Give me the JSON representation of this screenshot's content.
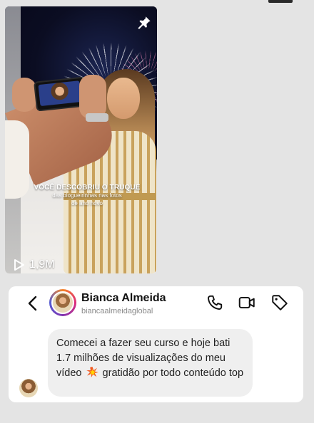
{
  "reel": {
    "caption_line1": "VOCÊ DESCOBRIU O TRUQUE",
    "caption_line2": "das blogueirinhas nas fotos",
    "caption_line3": "de ano novo",
    "views": "1,9M",
    "pin_icon": "pin-icon",
    "play_icon": "play-icon"
  },
  "dm": {
    "name": "Bianca Almeida",
    "handle": "biancaalmeidaglobal",
    "message_part1": "Comecei a fazer seu curso e hoje bati 1.7 milhões de visualizações do meu vídeo",
    "message_part2": "gratidão por todo conteúdo top",
    "emoji": "collision-emoji",
    "icons": [
      "back-icon",
      "phone-icon",
      "video-icon",
      "tag-icon"
    ],
    "accent_colors": [
      "#f58529",
      "#dd2a7b",
      "#8134af",
      "#515bd4"
    ]
  }
}
